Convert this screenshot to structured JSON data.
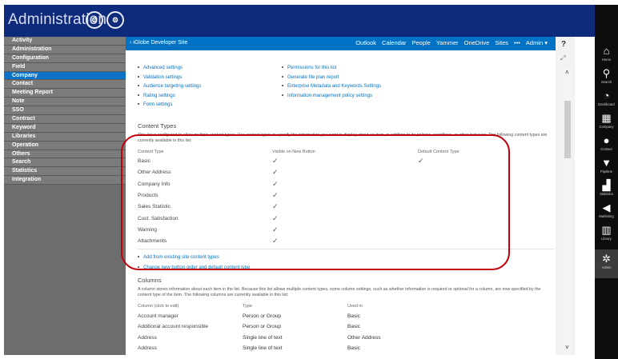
{
  "header": {
    "title": "Administration",
    "btn1": "⚙",
    "btn2": "⚙"
  },
  "leftnav": [
    {
      "label": "Activity",
      "active": false
    },
    {
      "label": "Administration",
      "active": false
    },
    {
      "label": "Configuration",
      "active": false
    },
    {
      "label": "Field",
      "active": false
    },
    {
      "label": "Company",
      "active": true
    },
    {
      "label": "Contact",
      "active": false
    },
    {
      "label": "Meeting Report",
      "active": false
    },
    {
      "label": "Note",
      "active": false
    },
    {
      "label": "SSO",
      "active": false
    },
    {
      "label": "Contract",
      "active": false
    },
    {
      "label": "Keyword",
      "active": false
    },
    {
      "label": "Libraries",
      "active": false
    },
    {
      "label": "Operation",
      "active": false
    },
    {
      "label": "Others",
      "active": false
    },
    {
      "label": "Search",
      "active": false
    },
    {
      "label": "Statistics",
      "active": false
    },
    {
      "label": "Integration",
      "active": false
    }
  ],
  "suitebar": {
    "site_name": "‹ iGlobe Developer Site",
    "links": [
      "Outlook",
      "Calendar",
      "People",
      "Yammer",
      "OneDrive",
      "Sites",
      "•••",
      "Admin ▾"
    ]
  },
  "help": {
    "icon": "?",
    "expand": "⤢"
  },
  "settings_left": [
    "Advanced settings",
    "Validation settings",
    "Audience targeting settings",
    "Rating settings",
    "Form settings"
  ],
  "settings_right": [
    "Permissions for this list",
    "Generate file plan report",
    "Enterprise Metadata and Keywords Settings",
    "Information management policy settings"
  ],
  "content_types": {
    "title": "Content Types",
    "description": "This list is configured to allow multiple content types. Use content types to specify the information you want to display about an item, in addition to its policies, workflows, or other behavior. The following content types are currently available in this list:",
    "col_type": "Content Type",
    "col_visible": "Visible on New Button",
    "col_default": "Default Content Type",
    "rows": [
      {
        "name": "Basic",
        "visible": "✓",
        "default": "✓"
      },
      {
        "name": "Other Address",
        "visible": "✓",
        "default": ""
      },
      {
        "name": "Company Info",
        "visible": "✓",
        "default": ""
      },
      {
        "name": "Products",
        "visible": "✓",
        "default": ""
      },
      {
        "name": "Sales Statistic",
        "visible": "✓",
        "default": ""
      },
      {
        "name": "Cust. Satisfaction",
        "visible": "✓",
        "default": ""
      },
      {
        "name": "Warning",
        "visible": "✓",
        "default": ""
      },
      {
        "name": "Attachments",
        "visible": "✓",
        "default": ""
      }
    ],
    "add_link": "Add from existing site content types",
    "order_link": "Change new button order and default content type"
  },
  "columns": {
    "title": "Columns",
    "description": "A column stores information about each item in the list. Because this list allows multiple content types, some column settings, such as whether information is required or optional for a column, are now specified by the content type of the item. The following columns are currently available in this list:",
    "col_name": "Column (click to edit)",
    "col_type": "Type",
    "col_used": "Used in",
    "rows": [
      {
        "name": "Account manager",
        "type": "Person or Group",
        "used": "Basic"
      },
      {
        "name": "Additional account responsible",
        "type": "Person or Group",
        "used": "Basic"
      },
      {
        "name": "Address",
        "type": "Single line of text",
        "used": "Other Address"
      },
      {
        "name": "Address",
        "type": "Single line of text",
        "used": "Basic"
      }
    ]
  },
  "scroll": {
    "up": "˄",
    "down": "˅"
  },
  "rail": [
    {
      "icon": "⌂",
      "label": "Home",
      "active": false
    },
    {
      "icon": "⚲",
      "label": "Search",
      "active": false
    },
    {
      "icon": "◔",
      "label": "Dashboard",
      "active": false
    },
    {
      "icon": "▦",
      "label": "Company",
      "active": false
    },
    {
      "icon": "●",
      "label": "Contact",
      "active": false
    },
    {
      "icon": "▼",
      "label": "Pipeline",
      "active": false
    },
    {
      "icon": "▟",
      "label": "Statistics",
      "active": false
    },
    {
      "icon": "◀",
      "label": "Marketing",
      "active": false
    },
    {
      "icon": "▥",
      "label": "Library",
      "active": false
    },
    {
      "icon": "✲",
      "label": "Admin",
      "active": true
    }
  ],
  "colors": {
    "header": "#0e2a7a",
    "suite": "#0072c6",
    "active_nav": "#0e72c6",
    "highlight": "#c0000a"
  }
}
